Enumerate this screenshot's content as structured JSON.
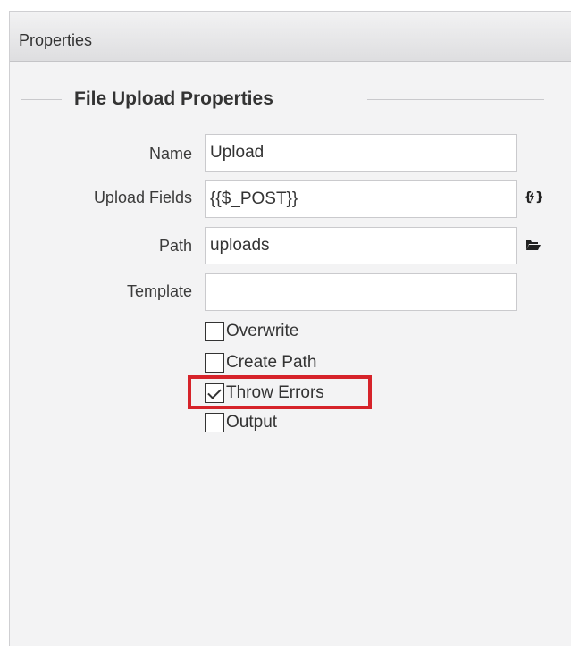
{
  "panel": {
    "title": "Properties"
  },
  "section": {
    "legend": "File Upload Properties"
  },
  "fields": {
    "name": {
      "label": "Name",
      "value": "Upload"
    },
    "upload_fields": {
      "label": "Upload Fields",
      "value": "{{$_POST}}",
      "action_icon": "dynamic-data-icon"
    },
    "path": {
      "label": "Path",
      "value": "uploads",
      "action_icon": "folder-open-icon"
    },
    "template": {
      "label": "Template",
      "value": ""
    }
  },
  "options": [
    {
      "label": "Overwrite",
      "checked": false
    },
    {
      "label": "Create Path",
      "checked": false
    },
    {
      "label": "Throw Errors",
      "checked": true
    },
    {
      "label": "Output",
      "checked": false
    }
  ],
  "colors": {
    "highlight": "#d6232a",
    "panel_bg": "#f3f3f4"
  }
}
